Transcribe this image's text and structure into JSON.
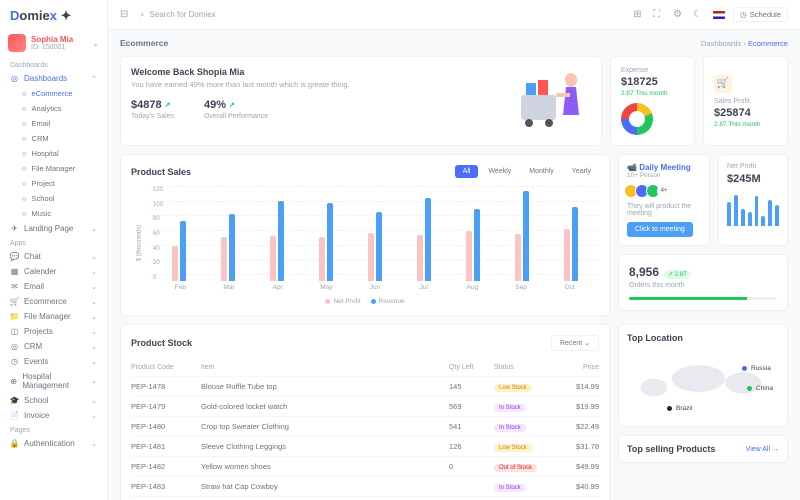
{
  "logo": {
    "text": "Domiex"
  },
  "user": {
    "name": "Sophia Mia",
    "id": "ID: 150001"
  },
  "search": {
    "placeholder": "Search for Domiex"
  },
  "schedule": "Schedule",
  "nav": {
    "sec1": "Dashboards",
    "dashboards": "Dashboards",
    "ecommerce": "eCommerce",
    "analytics": "Analytics",
    "email": "Email",
    "crm": "CRM",
    "hospital": "Hospital",
    "filemgr": "File Manager",
    "project": "Project",
    "school": "School",
    "music": "Music",
    "landing": "Landing Page",
    "sec2": "Apps",
    "chat": "Chat",
    "calendar": "Calender",
    "email2": "Email",
    "ecom2": "Ecommerce",
    "fm2": "File Manager",
    "projects": "Projects",
    "crm2": "CRM",
    "events": "Events",
    "hospmgmt": "Hospital Management",
    "school2": "School",
    "invoice": "Invoice",
    "sec3": "Pages",
    "auth": "Authentication",
    "pages": "Pages"
  },
  "crumb": {
    "title": "Ecommerce",
    "path": "Dashboards",
    "cur": "Ecommerce"
  },
  "welcome": {
    "title": "Welcome Back Shopia Mia",
    "sub": "You have earned 49% more than last month which is greate thing.",
    "sales": "$4878",
    "saleslab": "Today's Sales",
    "perf": "49%",
    "perflab": "Overall Performance"
  },
  "expense": {
    "lab": "Expense",
    "val": "$18725",
    "del": "2.87 This month"
  },
  "profit": {
    "lab": "Sales Profit",
    "val": "$25874",
    "del": "2.87 This month"
  },
  "chart": {
    "title": "Product Sales",
    "tabs": [
      "All",
      "Weekly",
      "Monthly",
      "Yearly"
    ],
    "leg1": "Net Profit",
    "leg2": "Revenue"
  },
  "chart_data": {
    "type": "bar",
    "categories": [
      "Feb",
      "Mar",
      "Apr",
      "May",
      "Jun",
      "Jul",
      "Aug",
      "Sep",
      "Oct"
    ],
    "series": [
      {
        "name": "Net Profit",
        "values": [
          44,
          55,
          57,
          56,
          61,
          58,
          63,
          60,
          66
        ]
      },
      {
        "name": "Revenue",
        "values": [
          76,
          85,
          101,
          98,
          87,
          105,
          91,
          114,
          94
        ]
      }
    ],
    "ylabel": "$ (thousands)",
    "ylim": [
      0,
      120
    ],
    "yticks": [
      0,
      20,
      40,
      60,
      80,
      100,
      120
    ]
  },
  "meeting": {
    "title": "Daily Meeting",
    "sub": "10+ Person",
    "txt": "They will product the meeting",
    "btn": "Click to meeting"
  },
  "netprofit": {
    "lab": "Net Profit",
    "val": "$245M",
    "bars": [
      70,
      90,
      50,
      40,
      85,
      30,
      75,
      60
    ]
  },
  "orders": {
    "val": "8,956",
    "badge": "↗ 2.87",
    "lab": "Orders this month"
  },
  "stock": {
    "title": "Product Stock",
    "recent": "Recent",
    "cols": [
      "Product Code",
      "Item",
      "Qty Left",
      "Status",
      "Price"
    ],
    "rows": [
      {
        "code": "PEP-1478",
        "item": "Blouse Ruffle Tube top",
        "qty": "145",
        "status": "Low Stock",
        "cls": "low",
        "price": "$14.99"
      },
      {
        "code": "PEP-1479",
        "item": "Gold-colored locket watch",
        "qty": "569",
        "status": "In Stock",
        "cls": "in",
        "price": "$19.99"
      },
      {
        "code": "PEP-1480",
        "item": "Crop top Sweater Clothing",
        "qty": "541",
        "status": "In Stock",
        "cls": "in",
        "price": "$22.49"
      },
      {
        "code": "PEP-1481",
        "item": "Sleeve Clothing Leggings",
        "qty": "126",
        "status": "Low Stock",
        "cls": "low",
        "price": "$31.78"
      },
      {
        "code": "PEP-1482",
        "item": "Yellow women shoes",
        "qty": "0",
        "status": "Out of Stock",
        "cls": "out",
        "price": "$49.99"
      },
      {
        "code": "PEP-1483",
        "item": "Straw hat Cap Cowboy",
        "qty": "",
        "status": "In Stock",
        "cls": "in",
        "price": "$40.99"
      }
    ]
  },
  "toploc": {
    "title": "Top Location",
    "locs": [
      {
        "name": "Russia",
        "c": "#4a6cf7"
      },
      {
        "name": "China",
        "c": "#22c55e"
      },
      {
        "name": "Brazil",
        "c": "#1e293b"
      }
    ]
  },
  "topprod": {
    "title": "Top selling Products",
    "link": "View All →"
  }
}
